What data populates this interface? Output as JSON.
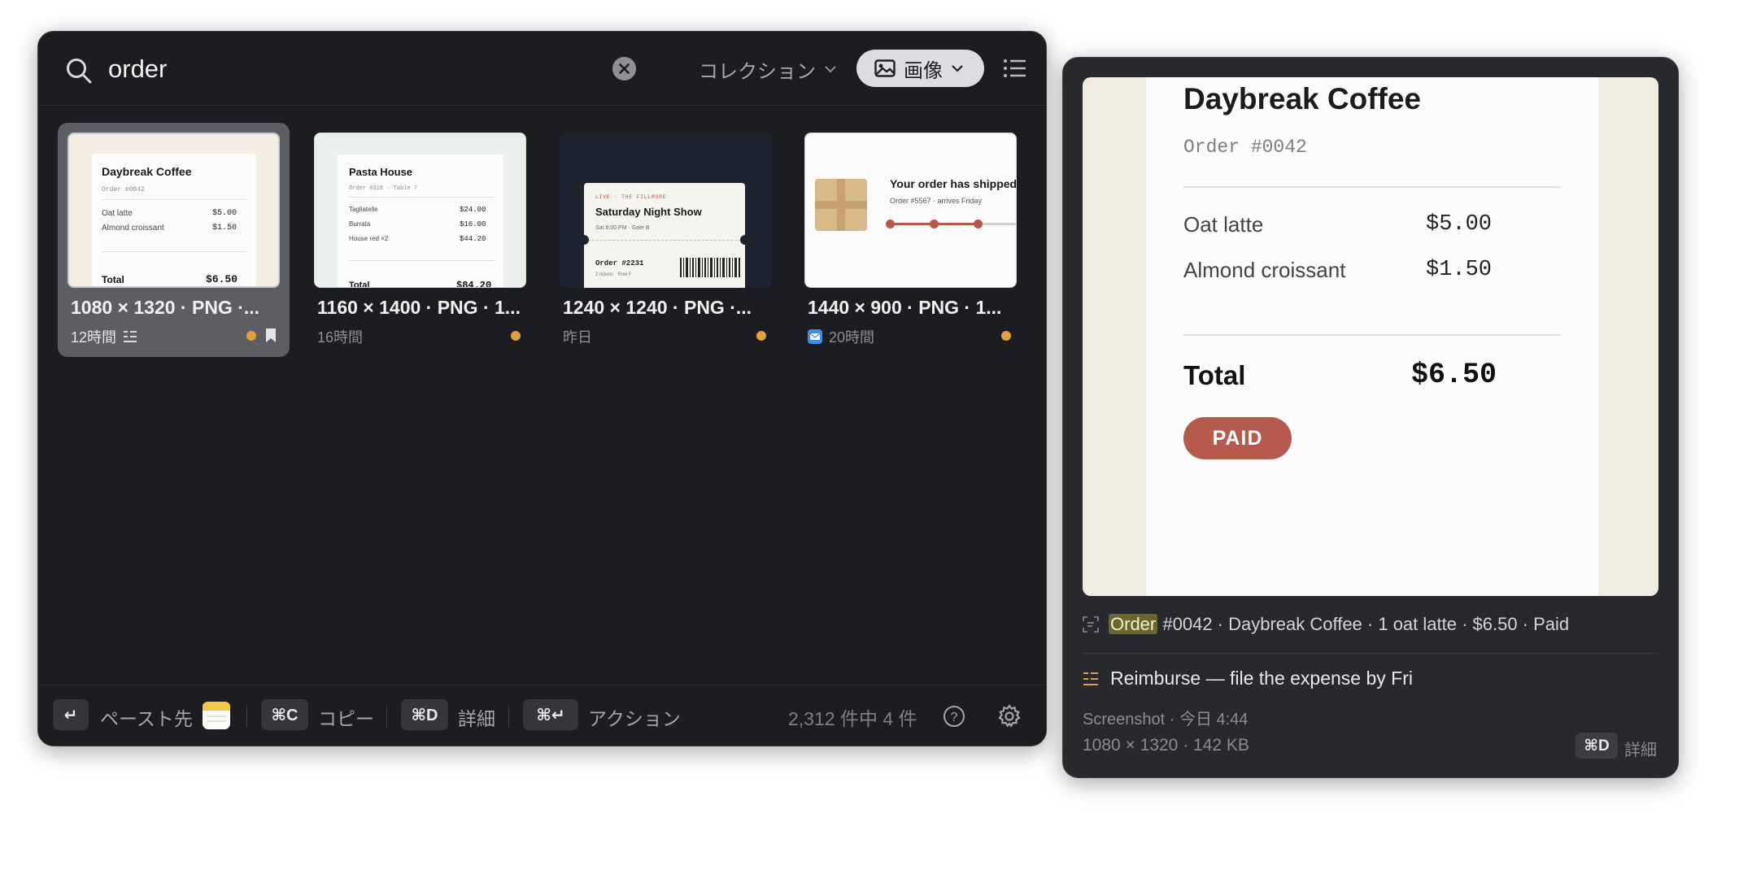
{
  "search": {
    "query": "order"
  },
  "filters": {
    "collection_label": "コレクション",
    "type_label": "画像"
  },
  "cards": [
    {
      "title": "1080 × 1320 · PNG ·...",
      "time": "12時間",
      "thumb": {
        "shop": "Daybreak Coffee",
        "order": "Order #0042",
        "items": [
          [
            "Oat latte",
            "$5.00"
          ],
          [
            "Almond croissant",
            "$1.50"
          ]
        ],
        "total_label": "Total",
        "total": "$6.50"
      }
    },
    {
      "title": "1160 × 1400 · PNG · 1...",
      "time": "16時間",
      "thumb": {
        "shop": "Pasta House",
        "order": "Order #318 · Table 7",
        "items": [
          [
            "Tagliatelle",
            "$24.00"
          ],
          [
            "Burrata",
            "$16.00"
          ],
          [
            "House red ×2",
            "$44.20"
          ]
        ],
        "total_label": "Total",
        "total": "$84.20"
      }
    },
    {
      "title": "1240 × 1240 · PNG ·...",
      "time": "昨日",
      "thumb": {
        "tag": "LIVE · THE FILLMORE",
        "event": "Saturday Night Show",
        "detail": "Sat 8:00 PM · Gate B",
        "order": "Order #2231",
        "seats": "2 tickets · Row F"
      }
    },
    {
      "title": "1440 × 900 · PNG · 1...",
      "time": "20時間",
      "thumb": {
        "headline": "Your order has shipped",
        "detail": "Order #5567 · arrives Friday"
      }
    }
  ],
  "footer": {
    "paste_key": "↵",
    "paste_label": "ペースト先",
    "copy_key": "⌘C",
    "copy_label": "コピー",
    "detail_key": "⌘D",
    "detail_label": "詳細",
    "action_key": "⌘↵",
    "action_label": "アクション",
    "count": "2,312 件中 4 件"
  },
  "preview": {
    "shop": "Daybreak Coffee",
    "order": "Order #0042",
    "items": [
      [
        "Oat latte",
        "$5.00"
      ],
      [
        "Almond croissant",
        "$1.50"
      ]
    ],
    "total_label": "Total",
    "total": "$6.50",
    "stamp": "PAID",
    "ocr_highlight": "Order",
    "ocr_rest": "#0042 · Daybreak Coffee · 1 oat latte · $6.50 · Paid",
    "note": "Reimburse — file the expense by Fri",
    "source": "Screenshot · 今日 4:44",
    "dims": "1080 × 1320 · 142 KB",
    "detail_key": "⌘D",
    "detail_label": "詳細"
  },
  "colors": {
    "accent_dot": "#e0a040",
    "paid": "#b65a4d",
    "window": "#1b1d21"
  }
}
